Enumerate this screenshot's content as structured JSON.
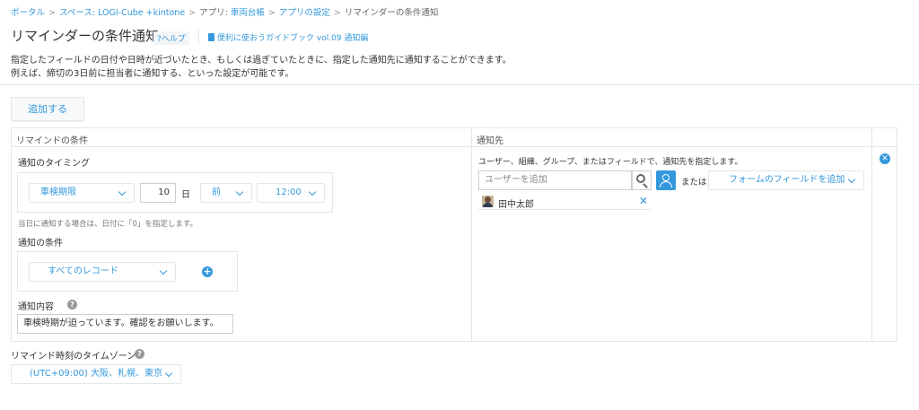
{
  "breadcrumb": [
    {
      "label": "ポータル",
      "link": true
    },
    {
      "label": "スペース: LOGI-Cube +kintone",
      "link": true
    },
    {
      "label": "アプリ: 車両台帳",
      "link": true,
      "parts": [
        "アプリ: ",
        "車両台帳"
      ]
    },
    {
      "label": "アプリの設定",
      "link": true
    },
    {
      "label": "リマインダーの条件通知",
      "link": false
    }
  ],
  "breadcrumb_parts": {
    "portal": "ポータル",
    "space": "スペース: LOGI-Cube +kintone",
    "app_prefix": "アプリ: ",
    "app_name": "車両台帳",
    "app_settings": "アプリの設定",
    "current": "リマインダーの条件通知",
    "separator": ">"
  },
  "header": {
    "title": "リマインダーの条件通知",
    "help_label": "?ヘルプ",
    "guide_label": "便利に使おうガイドブック vol.09 通知編"
  },
  "description": {
    "line1": "指定したフィールドの日付や日時が近づいたとき、もしくは過ぎていたときに、指定した通知先に通知することができます。",
    "line2": "例えば、締切の3日前に担当者に通知する、といった設定が可能です。"
  },
  "add_button_label": "追加する",
  "table": {
    "col_condition": "リマインドの条件",
    "col_recipient": "通知先"
  },
  "timing": {
    "label": "通知のタイミング",
    "field_select": "車検期限",
    "days_value": "10",
    "days_unit": "日",
    "before_after": "前",
    "time": "12:00",
    "note": "当日に通知する場合は、日付に「0」を指定します。"
  },
  "condition": {
    "label": "通知の条件",
    "select": "すべてのレコード"
  },
  "content": {
    "label": "通知内容",
    "value": "車検時期が迫っています。確認をお願いします。"
  },
  "recipient": {
    "hint": "ユーザー、組織、グループ、またはフィールドで、通知先を指定します。",
    "search_placeholder": "ユーザーを追加",
    "or_label": "または",
    "form_field_select": "フォームのフィールドを追加",
    "users": [
      {
        "name": "田中太郎"
      }
    ]
  },
  "timezone": {
    "label": "リマインド時刻のタイムゾーン",
    "value": "(UTC+09:00) 大阪、札幌、東京"
  },
  "colors": {
    "accent": "#3498db",
    "border": "#e3e7e8",
    "text": "#333333"
  }
}
